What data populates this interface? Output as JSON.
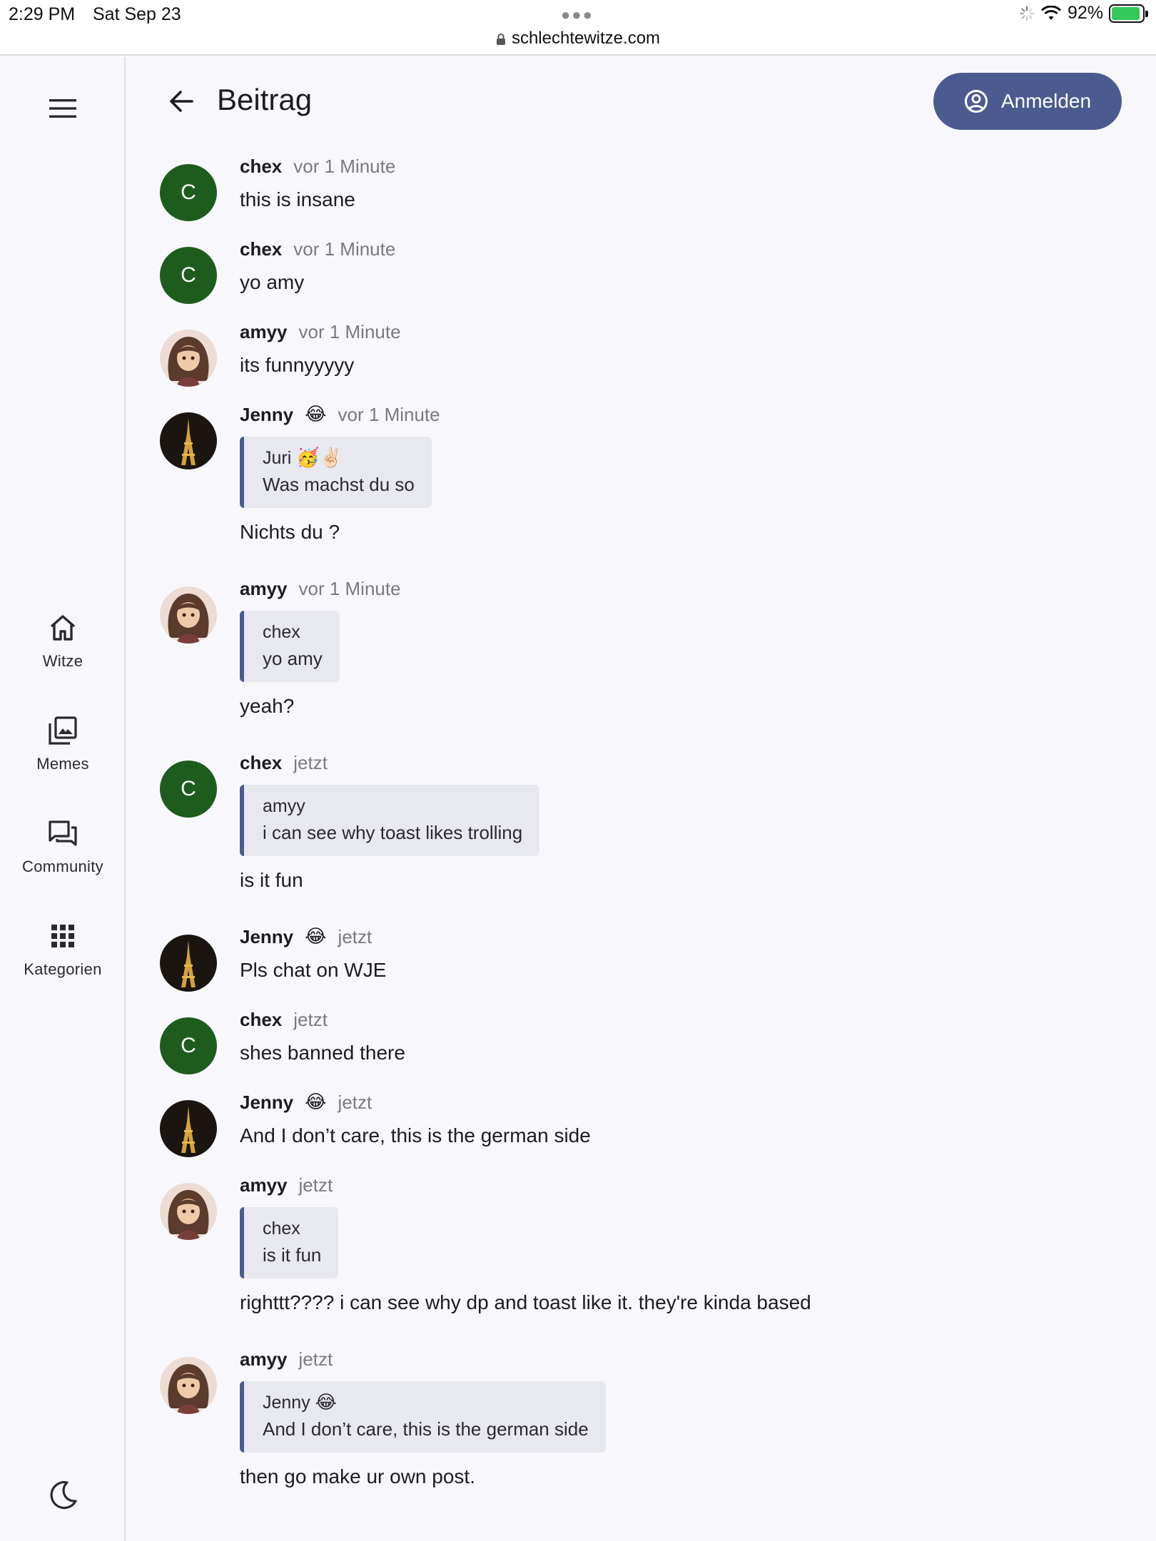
{
  "status_bar": {
    "time": "2:29 PM",
    "date": "Sat Sep 23",
    "url": "schlechtewitze.com",
    "battery": "92%",
    "battery_level": 0.92
  },
  "rail": {
    "items": [
      {
        "label": "Witze",
        "icon": "home-icon"
      },
      {
        "label": "Memes",
        "icon": "image-gallery-icon"
      },
      {
        "label": "Community",
        "icon": "forum-icon"
      },
      {
        "label": "Kategorien",
        "icon": "apps-grid-icon"
      }
    ]
  },
  "header": {
    "title": "Beitrag",
    "login_label": "Anmelden"
  },
  "messages": [
    {
      "author": "chex",
      "avatar": "C",
      "time": "vor 1 Minute",
      "text": "this is insane"
    },
    {
      "author": "chex",
      "avatar": "C",
      "time": "vor 1 Minute",
      "text": "yo amy"
    },
    {
      "author": "amyy",
      "time": "vor 1 Minute",
      "text": "its funnyyyyy"
    },
    {
      "author": "Jenny",
      "author_emoji": "😂",
      "time": "vor 1 Minute",
      "quote": {
        "author": "Juri",
        "author_emoji": "🥳✌🏻",
        "text": "Was machst du so"
      },
      "text": "Nichts du ?"
    },
    {
      "author": "amyy",
      "time": "vor 1 Minute",
      "quote": {
        "author": "chex",
        "text": "yo amy"
      },
      "text": "yeah?"
    },
    {
      "author": "chex",
      "avatar": "C",
      "time": "jetzt",
      "quote": {
        "author": "amyy",
        "text": "i can see why toast likes trolling"
      },
      "text": "is it fun"
    },
    {
      "author": "Jenny",
      "author_emoji": "😂",
      "time": "jetzt",
      "text": "Pls chat on WJE"
    },
    {
      "author": "chex",
      "avatar": "C",
      "time": "jetzt",
      "text": "shes banned there"
    },
    {
      "author": "Jenny",
      "author_emoji": "😂",
      "time": "jetzt",
      "text": "And I don’t care, this is the german side"
    },
    {
      "author": "amyy",
      "time": "jetzt",
      "quote": {
        "author": "chex",
        "text": "is it fun"
      },
      "text": "righttt???? i can see why dp and toast like it. they're kinda based"
    },
    {
      "author": "amyy",
      "time": "jetzt",
      "quote": {
        "author": "Jenny",
        "author_emoji": "😂",
        "text": "And I don’t care, this is the german side"
      },
      "text": "then go make ur own post."
    }
  ]
}
